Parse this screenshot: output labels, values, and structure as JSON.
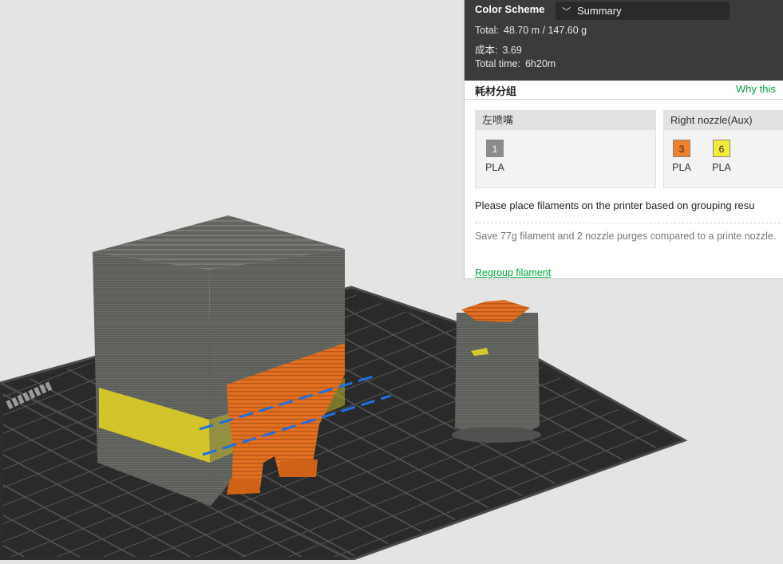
{
  "color_scheme": {
    "label": "Color Scheme",
    "chevron": "chevron-down-icon",
    "selected": "Summary"
  },
  "stats": {
    "total_label": "Total:",
    "total_value": "48.70 m / 147.60 g",
    "cost_label": "成本:",
    "cost_value": "3.69",
    "time_label": "Total time:",
    "time_value": "6h20m"
  },
  "grouping": {
    "title": "耗材分组",
    "why_link": "Why this",
    "left_nozzle": {
      "title": "左喷嘴",
      "filaments": [
        {
          "id": "1",
          "type": "PLA",
          "color": "#8c8c8c"
        }
      ]
    },
    "right_nozzle": {
      "title": "Right nozzle(Aux)",
      "filaments": [
        {
          "id": "3",
          "type": "PLA",
          "color": "#f07f2a"
        },
        {
          "id": "6",
          "type": "PLA",
          "color": "#f3ea3a"
        }
      ]
    },
    "placement_note": "Please place filaments on the printer based on grouping resu",
    "savings_note": "Save 77g filament and 2 nozzle purges compared to a printe nozzle.",
    "regroup_link": "Regroup filament"
  },
  "viewport": {
    "colors": {
      "background": "#e4e4e4",
      "plate": "#2c2c2c",
      "model_gray": "#5d5f5a",
      "model_top": "#6a6c67",
      "support_orange": "#e06d1c",
      "band_yellow": "#d6c82c",
      "guide_blue": "#1f6fe0"
    }
  }
}
